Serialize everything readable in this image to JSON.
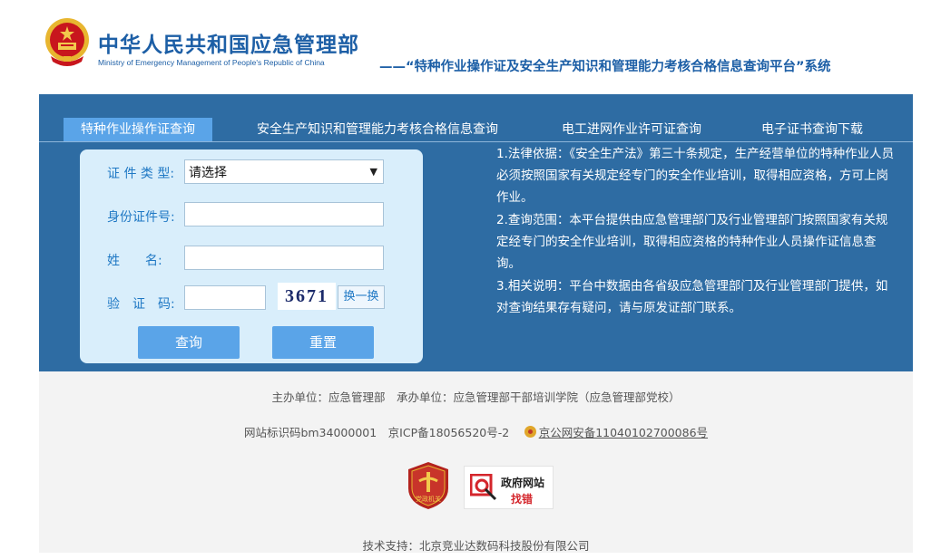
{
  "header": {
    "title_cn": "中华人民共和国应急管理部",
    "title_en": "Ministry of Emergency Management of People's Republic of China",
    "subtitle": "——“特种作业操作证及安全生产知识和管理能力考核合格信息查询平台”系统"
  },
  "tabs": [
    {
      "label": "特种作业操作证查询",
      "active": true
    },
    {
      "label": "安全生产知识和管理能力考核合格信息查询",
      "active": false
    },
    {
      "label": "电工进网作业许可证查询",
      "active": false
    },
    {
      "label": "电子证书查询下载",
      "active": false
    }
  ],
  "form": {
    "cert_type_label": "证 件 类 型:",
    "cert_type_value": "请选择",
    "id_label": "身份证件号:",
    "id_value": "",
    "name_label": "姓　　名:",
    "name_value": "",
    "captcha_label": "验　证　码:",
    "captcha_value": "",
    "captcha_text": "3671",
    "refresh_label": "换一换",
    "query_button": "查询",
    "reset_button": "重置"
  },
  "info": {
    "p1": "1.法律依据：《安全生产法》第三十条规定，生产经营单位的特种作业人员必须按照国家有关规定经专门的安全作业培训，取得相应资格，方可上岗作业。",
    "p2": "2.查询范围：本平台提供由应急管理部门及行业管理部门按照国家有关规定经专门的安全作业培训，取得相应资格的特种作业人员操作证信息查询。",
    "p3": "3.相关说明：平台中数据由各省级应急管理部门及行业管理部门提供，如对查询结果存有疑问，请与原发证部门联系。"
  },
  "footer": {
    "sponsor": "主办单位：应急管理部　承办单位：应急管理部干部培训学院（应急管理部党校）",
    "site_id": "网站标识码bm34000001　京ICP备18056520号-2",
    "police_record": "京公网安备11040102700086号",
    "badge_party": "党政机关",
    "badge_gov_line1": "政府网站",
    "badge_gov_line2": "找错",
    "support": "技术支持：北京竞业达数码科技股份有限公司"
  },
  "colors": {
    "brand_blue": "#1d5fa6",
    "band_blue": "#2e6ca3",
    "accent_blue": "#5aa4e8",
    "card_bg": "#d9eefb",
    "emblem_red": "#c8161d",
    "emblem_gold": "#f2c94c"
  }
}
